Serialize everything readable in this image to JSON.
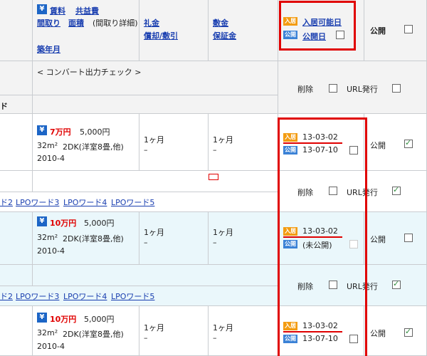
{
  "header": {
    "rent_label": "賃料",
    "common_fee_label": "共益費",
    "layout_label": "間取り",
    "area_label": "面積",
    "layout_detail": "(間取り詳細)",
    "built_label": "築年月",
    "key_money_label": "礼金",
    "deposit_dep_label": "償却/敷引",
    "deposit_label": "敷金",
    "security_label": "保証金",
    "move_in_badge": "入居",
    "move_in_label": "入居可能日",
    "publish_badge": "公開",
    "publish_date_label": "公開日",
    "public_label": "公開",
    "convert_check": "< コンバート出力チェック >",
    "delete_label": "削除",
    "url_issue_label": "URL発行",
    "left_cut": "ド"
  },
  "rows": [
    {
      "price": "7万円",
      "fee": "5,000円",
      "area": "32m²",
      "layout": "2DK(洋室8畳,他)",
      "built": "2010-4",
      "key_money": "1ヶ月",
      "deposit_dep": "–",
      "deposit": "1ヶ月",
      "security": "–",
      "move_in_badge": "入居",
      "move_in_date": "13-03-02",
      "publish_badge": "公開",
      "publish_date": "13-07-10",
      "public_label": "公開"
    },
    {
      "price": "10万円",
      "fee": "5,000円",
      "area": "32m²",
      "layout": "2DK(洋室8畳,他)",
      "built": "2010-4",
      "key_money": "1ヶ月",
      "deposit_dep": "–",
      "deposit": "1ヶ月",
      "security": "–",
      "move_in_badge": "入居",
      "move_in_date": "13-03-02",
      "publish_badge": "公開",
      "publish_date": "(未公開)",
      "public_label": "公開"
    },
    {
      "price": "10万円",
      "fee": "5,000円",
      "area": "32m²",
      "layout": "2DK(洋室8畳,他)",
      "built": "2010-4",
      "key_money": "1ヶ月",
      "deposit_dep": "–",
      "deposit": "1ヶ月",
      "security": "–",
      "move_in_badge": "入居",
      "move_in_date": "13-03-02",
      "publish_badge": "公開",
      "publish_date": "13-07-10",
      "public_label": "公開"
    }
  ],
  "lpo_links": {
    "row1": [
      "ド2",
      "LPOワード3",
      "LPOワード4",
      "LPOワード5"
    ],
    "row2": [
      "ド2",
      "LPOワード3",
      "LPOワード4",
      "LPOワード5"
    ]
  },
  "sub_rows": {
    "delete_label": "削除",
    "url_issue_label": "URL発行"
  },
  "colors": {
    "highlight_red": "#e00000",
    "link_blue": "#1a3fb0",
    "badge_orange": "#f39c12",
    "badge_blue": "#3b82d6",
    "row_bg_blue": "#eaf7fb"
  }
}
